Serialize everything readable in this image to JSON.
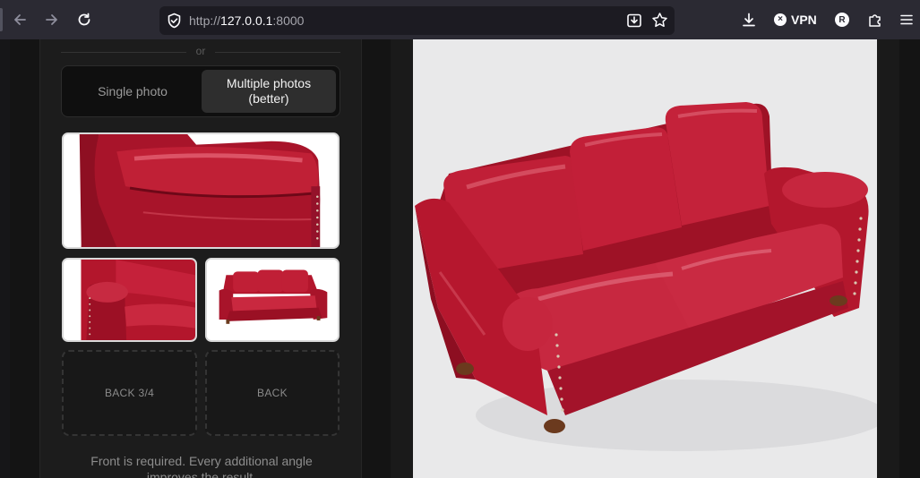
{
  "browser": {
    "url_prefix": "http://",
    "url_host": "127.0.0.1",
    "url_port": ":8000",
    "vpn_label": "VPN",
    "vpn_badge": "×",
    "account_initial": "R",
    "icons": [
      "back-arrow-icon",
      "forward-arrow-icon",
      "reload-icon",
      "shield-icon",
      "save-page-icon",
      "bookmark-star-icon",
      "download-icon",
      "extensions-icon",
      "menu-icon"
    ]
  },
  "uploader": {
    "divider_text": "or",
    "mode_single": "Single photo",
    "mode_multi_line1": "Multiple photos",
    "mode_multi_line2": "(better)",
    "selected_mode": "multi",
    "slots": [
      {
        "label": "BACK 3/4"
      },
      {
        "label": "BACK"
      }
    ],
    "hint_line1": "Front is required. Every additional angle",
    "hint_line2": "improves the result."
  },
  "colors": {
    "sofa_red": "#b3162c",
    "sofa_dark": "#7a0a1a",
    "sofa_highlight": "#e06070",
    "legs": "#6b3a1e",
    "preview_bg": "#e9e9ea"
  }
}
